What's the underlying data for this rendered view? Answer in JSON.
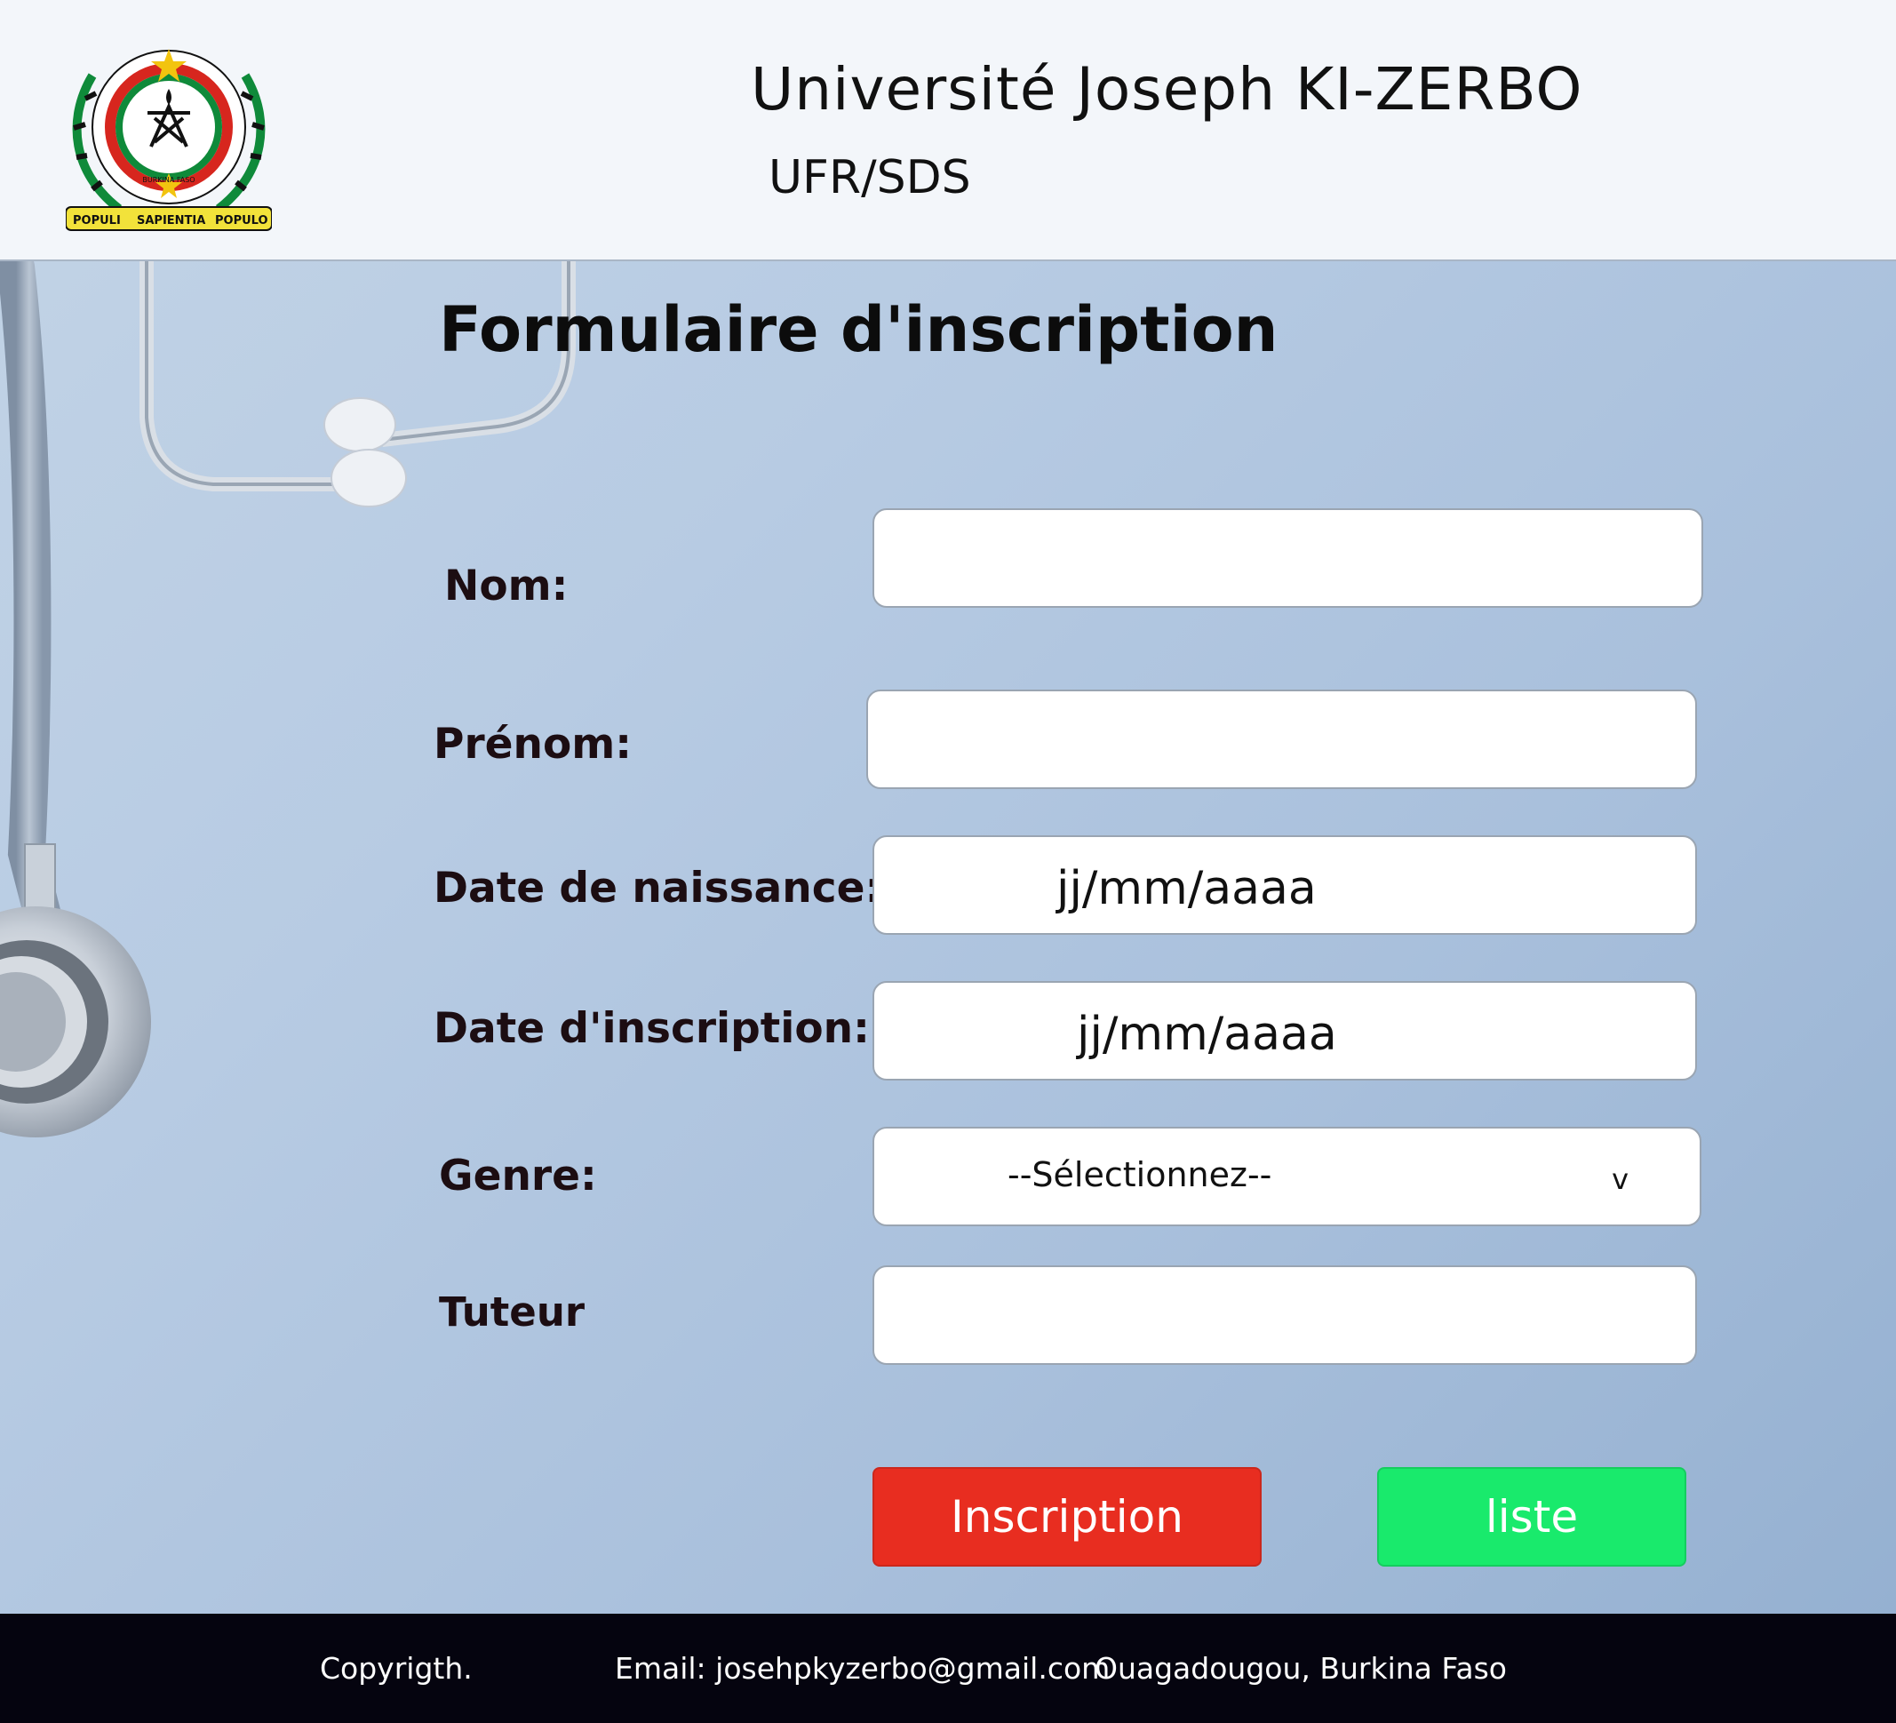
{
  "header": {
    "university_name": "Université Joseph KI-ZERBO",
    "faculty": "UFR/SDS",
    "logo": {
      "ring_text": "UNIVERSITE DE OUAGADOUGOU",
      "country_text": "BURKINA FASO",
      "motto": [
        "POPULI",
        "SAPIENTIA",
        "POPULO"
      ],
      "icon": "university-emblem-icon",
      "colors": {
        "red": "#d7261e",
        "green": "#0f8a3a",
        "gold": "#f2c40f"
      }
    }
  },
  "form": {
    "title": "Formulaire d'inscription",
    "nom": {
      "label": "Nom:",
      "value": ""
    },
    "prenom": {
      "label": "Prénom:",
      "value": ""
    },
    "date_naissance": {
      "label": "Date de naissance:",
      "placeholder": "jj/mm/aaaa"
    },
    "date_inscription": {
      "label": "Date d'inscription:",
      "placeholder": "jj/mm/aaaa"
    },
    "genre": {
      "label": "Genre:",
      "selected": "--Sélectionnez--",
      "arrow": "v"
    },
    "tuteur": {
      "label": "Tuteur",
      "value": ""
    }
  },
  "buttons": {
    "inscription": "Inscription",
    "liste": "liste",
    "colors": {
      "inscription": "#e82d20",
      "liste": "#19ea6c"
    }
  },
  "footer": {
    "copyright": "Copyrigth.",
    "email": "Email: josehpkyzerbo@gmail.com",
    "location": "Ouagadougou, Burkina Faso"
  },
  "background": {
    "theme": "stethoscope-on-blue",
    "icon": "stethoscope-icon"
  }
}
